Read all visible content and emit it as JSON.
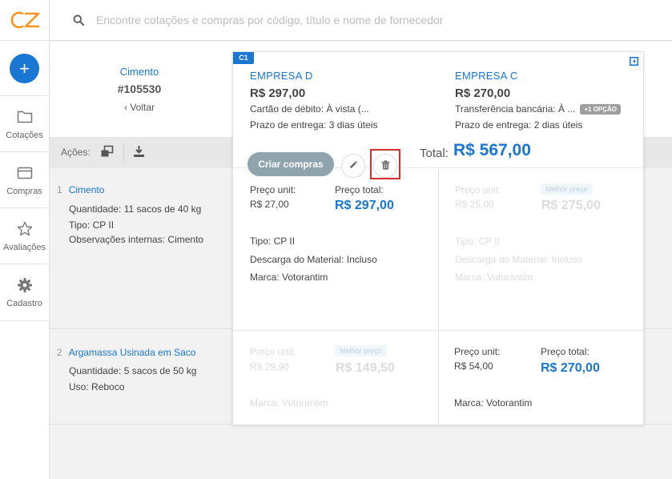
{
  "app": {
    "logo_text": "CZ",
    "brand_color": "#f7941d",
    "accent_color": "#1976d2"
  },
  "search": {
    "placeholder": "Encontre cotações e compras por código, título e nome de fornecedor"
  },
  "sidebar": {
    "add_label": "+",
    "items": [
      {
        "label": "Cotações",
        "icon": "folder-icon"
      },
      {
        "label": "Compras",
        "icon": "card-icon"
      },
      {
        "label": "Avaliações",
        "icon": "star-icon"
      },
      {
        "label": "Cadastro",
        "icon": "gear-icon"
      }
    ]
  },
  "quote": {
    "title": "Cimento",
    "code": "#105530",
    "back_label": "‹ Voltar"
  },
  "actions": {
    "label": "Ações:"
  },
  "items": [
    {
      "number": "1",
      "title": "Cimento",
      "details": [
        {
          "key": "Quantidade:",
          "value": "11 sacos de 40 kg"
        },
        {
          "key": "Tipo:",
          "value": "CP II"
        },
        {
          "key": "Observações internas:",
          "value": "Cimento"
        }
      ]
    },
    {
      "number": "2",
      "title": "Argamassa Usinada em Saco",
      "details": [
        {
          "key": "Quantidade:",
          "value": "5 sacos de 50 kg"
        },
        {
          "key": "Uso:",
          "value": "Reboco"
        }
      ]
    }
  ],
  "card": {
    "badge": "C1",
    "create_label": "Criar compras",
    "total_label": "Total:",
    "total_value": "R$ 567,00",
    "suppliers": [
      {
        "name": "EMPRESA D",
        "price": "R$ 297,00",
        "payment_key": "Cartão de débito:",
        "payment_value": "À vista (...",
        "delivery_key": "Prazo de entrega:",
        "delivery_value": "3 dias úteis"
      },
      {
        "name": "EMPRESA C",
        "price": "R$ 270,00",
        "payment_key": "Transferência bancária:",
        "payment_value": "À ...",
        "more_options": "+1 OPÇÃO",
        "delivery_key": "Prazo de entrega:",
        "delivery_value": "2 dias úteis"
      }
    ],
    "cells": {
      "d_item1": {
        "unit_label": "Preço unit:",
        "unit_value": "R$ 27,00",
        "total_label": "Preço total:",
        "total_value": "R$ 297,00",
        "attrs": [
          {
            "key": "Tipo:",
            "value": "CP II"
          },
          {
            "key": "Descarga do Material:",
            "value": "Incluso"
          },
          {
            "key": "Marca:",
            "value": "Votorantim"
          }
        ]
      },
      "c_item1": {
        "unit_label": "Preço unit:",
        "unit_value": "R$ 25,00",
        "best": "Melhor preço",
        "total_value": "R$ 275,00",
        "attrs": [
          {
            "key": "Tipo:",
            "value": "CP II"
          },
          {
            "key": "Descarga do Material:",
            "value": "Incluso"
          },
          {
            "key": "Marca:",
            "value": "Votorantim"
          }
        ]
      },
      "d_item2": {
        "unit_label": "Preço unit:",
        "unit_value": "R$ 29,90",
        "best": "Melhor preço",
        "total_value": "R$ 149,50",
        "attrs": [
          {
            "key": "Marca:",
            "value": "Votorantim"
          }
        ]
      },
      "c_item2": {
        "unit_label": "Preço unit:",
        "unit_value": "R$ 54,00",
        "total_label": "Preço total:",
        "total_value": "R$ 270,00",
        "attrs": [
          {
            "key": "Marca:",
            "value": "Votorantim"
          }
        ]
      }
    }
  }
}
